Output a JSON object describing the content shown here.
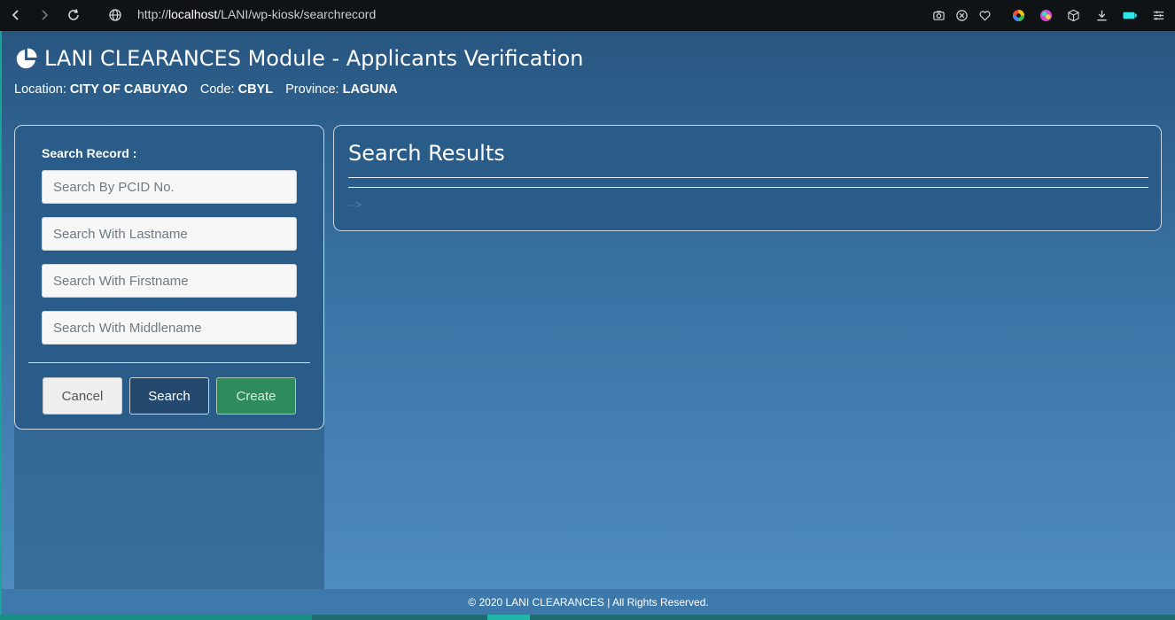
{
  "browser": {
    "url_scheme": "http://",
    "url_host": "localhost",
    "url_path": "/LANI/wp-kiosk/searchrecord",
    "icons": [
      "back-icon",
      "forward-icon",
      "reload-icon",
      "globe-icon",
      "camera-icon",
      "shield-icon",
      "heart-icon",
      "color-wheel-icon",
      "palette-icon",
      "box-icon",
      "download-icon",
      "battery-icon",
      "menu-icon"
    ]
  },
  "header": {
    "title": "LANI CLEARANCES Module - Applicants Verification",
    "location_label": "Location:",
    "location_value": "CITY OF CABUYAO",
    "code_label": "Code:",
    "code_value": "CBYL",
    "province_label": "Province:",
    "province_value": "LAGUNA"
  },
  "search_panel": {
    "label": "Search Record :",
    "pcid_placeholder": "Search By PCID No.",
    "lastname_placeholder": "Search With Lastname",
    "firstname_placeholder": "Search With Firstname",
    "middlename_placeholder": "Search With Middlename",
    "cancel_label": "Cancel",
    "search_label": "Search",
    "create_label": "Create"
  },
  "results_panel": {
    "title": "Search Results",
    "marker": "-->"
  },
  "footer": {
    "text": "© 2020 LANI CLEARANCES | All Rights Reserved."
  },
  "colors": {
    "page_top": "#275680",
    "page_bottom": "#508ec0",
    "create_green": "#2e8b5c",
    "search_navy": "#234a6e"
  }
}
